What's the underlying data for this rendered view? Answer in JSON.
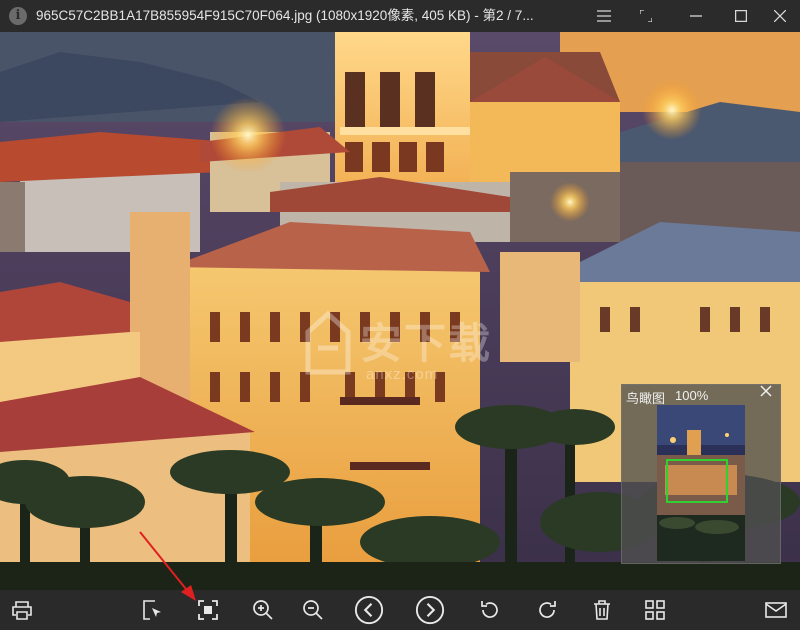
{
  "window": {
    "title": "965C57C2BB1A17B855954F915C70F064.jpg (1080x1920像素, 405 KB) - 第2 / 7..."
  },
  "watermark": {
    "text": "安下载",
    "sub": "anxz.com"
  },
  "birdseye": {
    "label": "鸟瞰图",
    "zoom": "100%"
  },
  "toolbar": {
    "buttons": [
      "print",
      "select-region",
      "fit-screen",
      "zoom-in",
      "zoom-out",
      "previous",
      "next",
      "rotate-left",
      "rotate-right",
      "delete",
      "grid-view",
      "email"
    ]
  },
  "colors": {
    "titlebar": "#2b2b2b",
    "toolbar": "#2a2a2a",
    "frame": "#2fd02f",
    "annotation_arrow": "#e02020"
  }
}
